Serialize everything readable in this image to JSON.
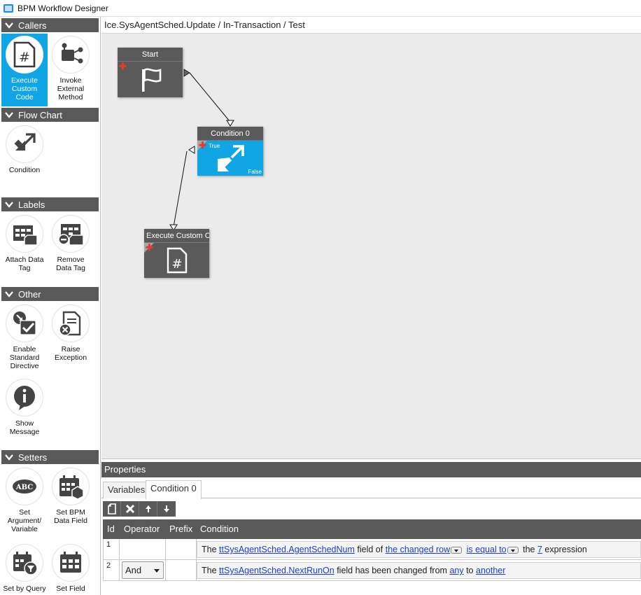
{
  "window": {
    "title": "BPM Workflow Designer"
  },
  "palette": {
    "sections": {
      "callers": "Callers",
      "flow_chart": "Flow Chart",
      "labels": "Labels",
      "other": "Other",
      "setters": "Setters"
    },
    "tools": {
      "execute_custom_code": "Execute Custom Code",
      "invoke_external_method": "Invoke External Method",
      "condition": "Condition",
      "attach_data_tag": "Attach Data Tag",
      "remove_data_tag": "Remove Data Tag",
      "enable_standard_directive": "Enable Standard Directive",
      "raise_exception": "Raise Exception",
      "show_message": "Show Message",
      "set_argument_variable": "Set Argument/ Variable",
      "set_bpm_data_field": "Set BPM Data Field",
      "set_by_query": "Set by Query",
      "set_field": "Set Field"
    },
    "selected_tool": "execute_custom_code"
  },
  "breadcrumb": "Ice.SysAgentSched.Update / In-Transaction / Test",
  "canvas": {
    "nodes": {
      "start": {
        "title": "Start"
      },
      "condition": {
        "title": "Condition 0",
        "true_label": "True",
        "false_label": "False"
      },
      "custom_code": {
        "title": "Execute Custom Co"
      }
    }
  },
  "properties": {
    "title": "Properties",
    "tabs": [
      "Variables",
      "Condition 0"
    ],
    "active_tab": "Condition 0",
    "grid": {
      "columns": {
        "id": "Id",
        "operator": "Operator",
        "prefix": "Prefix",
        "condition": "Condition"
      },
      "rows": [
        {
          "id": "1",
          "operator": "",
          "prefix": "",
          "cond": {
            "t1": "The",
            "field": "ttSysAgentSched.AgentSchedNum",
            "t2": "field of",
            "row": "the changed row",
            "comparison": "is equal to",
            "t3": "the",
            "value": "7",
            "t4": "expression"
          }
        },
        {
          "id": "2",
          "operator": "And",
          "prefix": "",
          "cond": {
            "t1": "The",
            "field": "ttSysAgentSched.NextRunOn",
            "t2": "field has been changed from",
            "from": "any",
            "t3": "to",
            "to": "another"
          }
        }
      ]
    }
  },
  "colors": {
    "accent": "#10a5e4",
    "header": "#595959",
    "canvas": "#ebebeb",
    "link": "#1a3fd0",
    "plus": "#e53935"
  }
}
